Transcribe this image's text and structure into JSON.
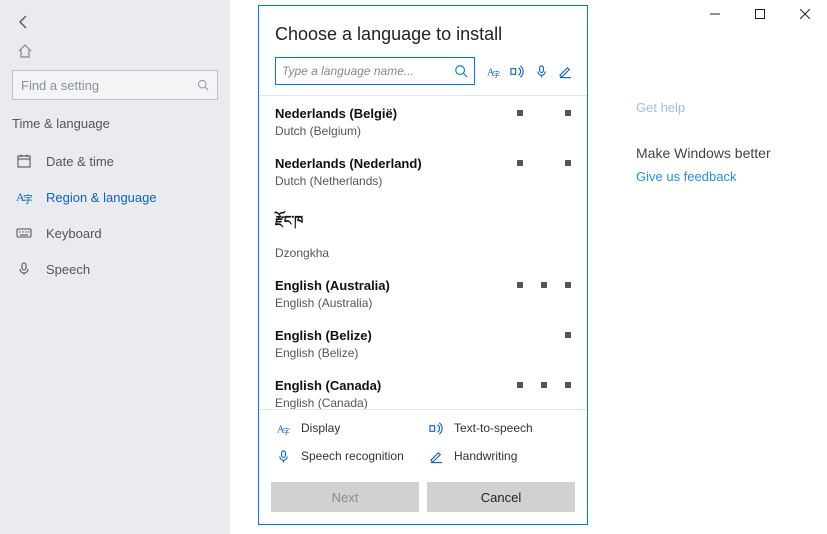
{
  "window": {
    "minimize": "Minimize",
    "maximize": "Maximize",
    "close": "Close"
  },
  "sidebar": {
    "search_placeholder": "Find a setting",
    "section_title": "Time & language",
    "items": [
      {
        "label": "Date & time",
        "icon": "calendar-icon"
      },
      {
        "label": "Region & language",
        "icon": "globe-icon"
      },
      {
        "label": "Keyboard",
        "icon": "keyboard-icon"
      },
      {
        "label": "Speech",
        "icon": "microphone-icon"
      }
    ]
  },
  "right": {
    "help_link": "Get help",
    "heading": "Make Windows better",
    "feedback_link": "Give us feedback"
  },
  "dialog": {
    "title": "Choose a language to install",
    "search_placeholder": "Type a language name...",
    "languages": [
      {
        "native": "Nederlands (België)",
        "english": "Dutch (Belgium)",
        "features": [
          false,
          true,
          false,
          true
        ]
      },
      {
        "native": "Nederlands (Nederland)",
        "english": "Dutch (Netherlands)",
        "features": [
          false,
          true,
          false,
          true
        ]
      },
      {
        "native": "རྫོང་ཁ",
        "english": "Dzongkha",
        "features": [
          false,
          false,
          false,
          false
        ]
      },
      {
        "native": "English (Australia)",
        "english": "English (Australia)",
        "features": [
          false,
          true,
          true,
          true
        ]
      },
      {
        "native": "English (Belize)",
        "english": "English (Belize)",
        "features": [
          false,
          false,
          false,
          true
        ]
      },
      {
        "native": "English (Canada)",
        "english": "English (Canada)",
        "features": [
          false,
          true,
          true,
          true
        ]
      }
    ],
    "legend": {
      "display": "Display",
      "tts": "Text-to-speech",
      "speech": "Speech recognition",
      "handwriting": "Handwriting"
    },
    "buttons": {
      "next": "Next",
      "cancel": "Cancel"
    }
  }
}
